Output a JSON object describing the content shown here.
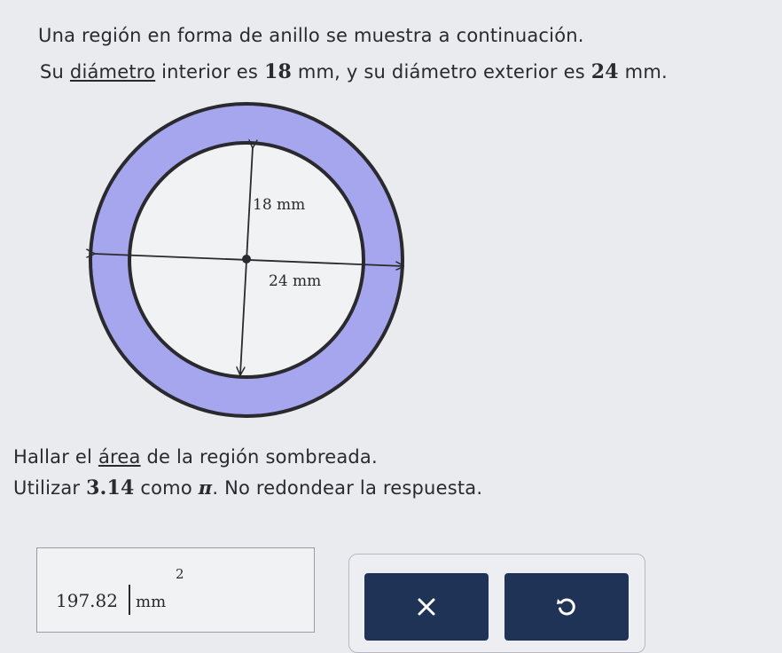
{
  "problem": {
    "line1": "Una región en forma de anillo se muestra a continuación.",
    "line2": {
      "prefix": "Su ",
      "term": "diámetro",
      "middle": " interior es ",
      "inner_value": "18",
      "unit1": " mm, y su diámetro exterior es ",
      "outer_value": "24",
      "unit2": " mm."
    },
    "line3": {
      "prefix": "Hallar el ",
      "term": "área",
      "suffix": " de la región sombreada."
    },
    "line4": {
      "prefix": "Utilizar ",
      "value": "3.14",
      "middle": " como ",
      "pi": "π",
      "suffix": ". No redondear la respuesta."
    }
  },
  "figure": {
    "inner_label": "18 mm",
    "outer_label": "24 mm",
    "ring_color": "#a6a6ee",
    "inner_color": "#f1f2f4"
  },
  "answer": {
    "value": "197.82",
    "unit": "mm",
    "exponent": "2"
  },
  "buttons": {
    "clear_icon": "x-icon",
    "undo_icon": "undo-icon"
  }
}
